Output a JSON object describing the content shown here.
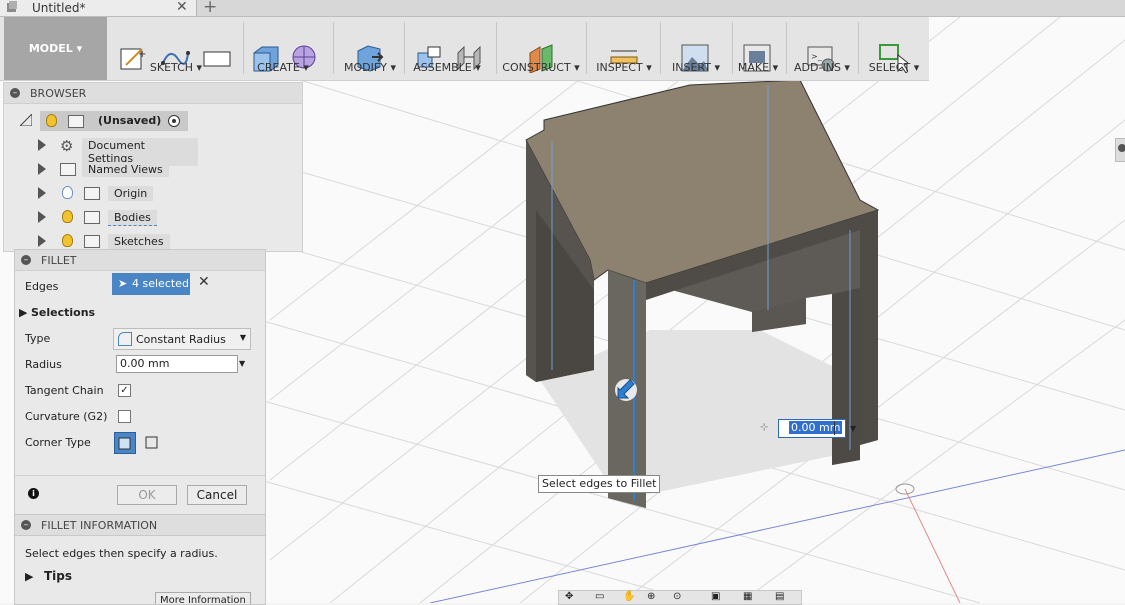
{
  "tab": {
    "title": "Untitled*",
    "close": "✕",
    "new": "+"
  },
  "toolbar": {
    "workspace": "MODEL ▾",
    "groups": {
      "sketch": "SKETCH ▾",
      "create": "CREATE ▾",
      "modify": "MODIFY ▾",
      "assemble": "ASSEMBLE ▾",
      "construct": "CONSTRUCT ▾",
      "inspect": "INSPECT ▾",
      "insert": "INSERT ▾",
      "make": "MAKE ▾",
      "addins": "ADD-INS ▾",
      "select": "SELECT ▾"
    }
  },
  "browser": {
    "title": "BROWSER",
    "root": "(Unsaved)",
    "nodes": [
      "Document Settings",
      "Named Views",
      "Origin",
      "Bodies",
      "Sketches"
    ]
  },
  "fillet": {
    "title": "FILLET",
    "edges_label": "Edges",
    "edges_value": "4 selected",
    "edges_clear": "✕",
    "selections_label": "Selections",
    "type_label": "Type",
    "type_value": "Constant Radius",
    "radius_label": "Radius",
    "radius_value": "0.00 mm",
    "tangent_label": "Tangent Chain",
    "tangent_checked": "✓",
    "curvature_label": "Curvature (G2)",
    "corner_label": "Corner Type",
    "info_glyph": "i",
    "ok_label": "OK",
    "cancel_label": "Cancel"
  },
  "fillet_info": {
    "title": "FILLET INFORMATION",
    "text": "Select edges then specify a radius.",
    "tips": "Tips",
    "more": "More Information"
  },
  "viewport": {
    "tooltip": "Select edges to Fillet",
    "radius_input": "0.00 mm"
  },
  "colors": {
    "accent": "#4a86c5",
    "top_face": "#8c7f6c",
    "side_face": "#5d5a55",
    "selected_edge": "#2d7fd0"
  }
}
